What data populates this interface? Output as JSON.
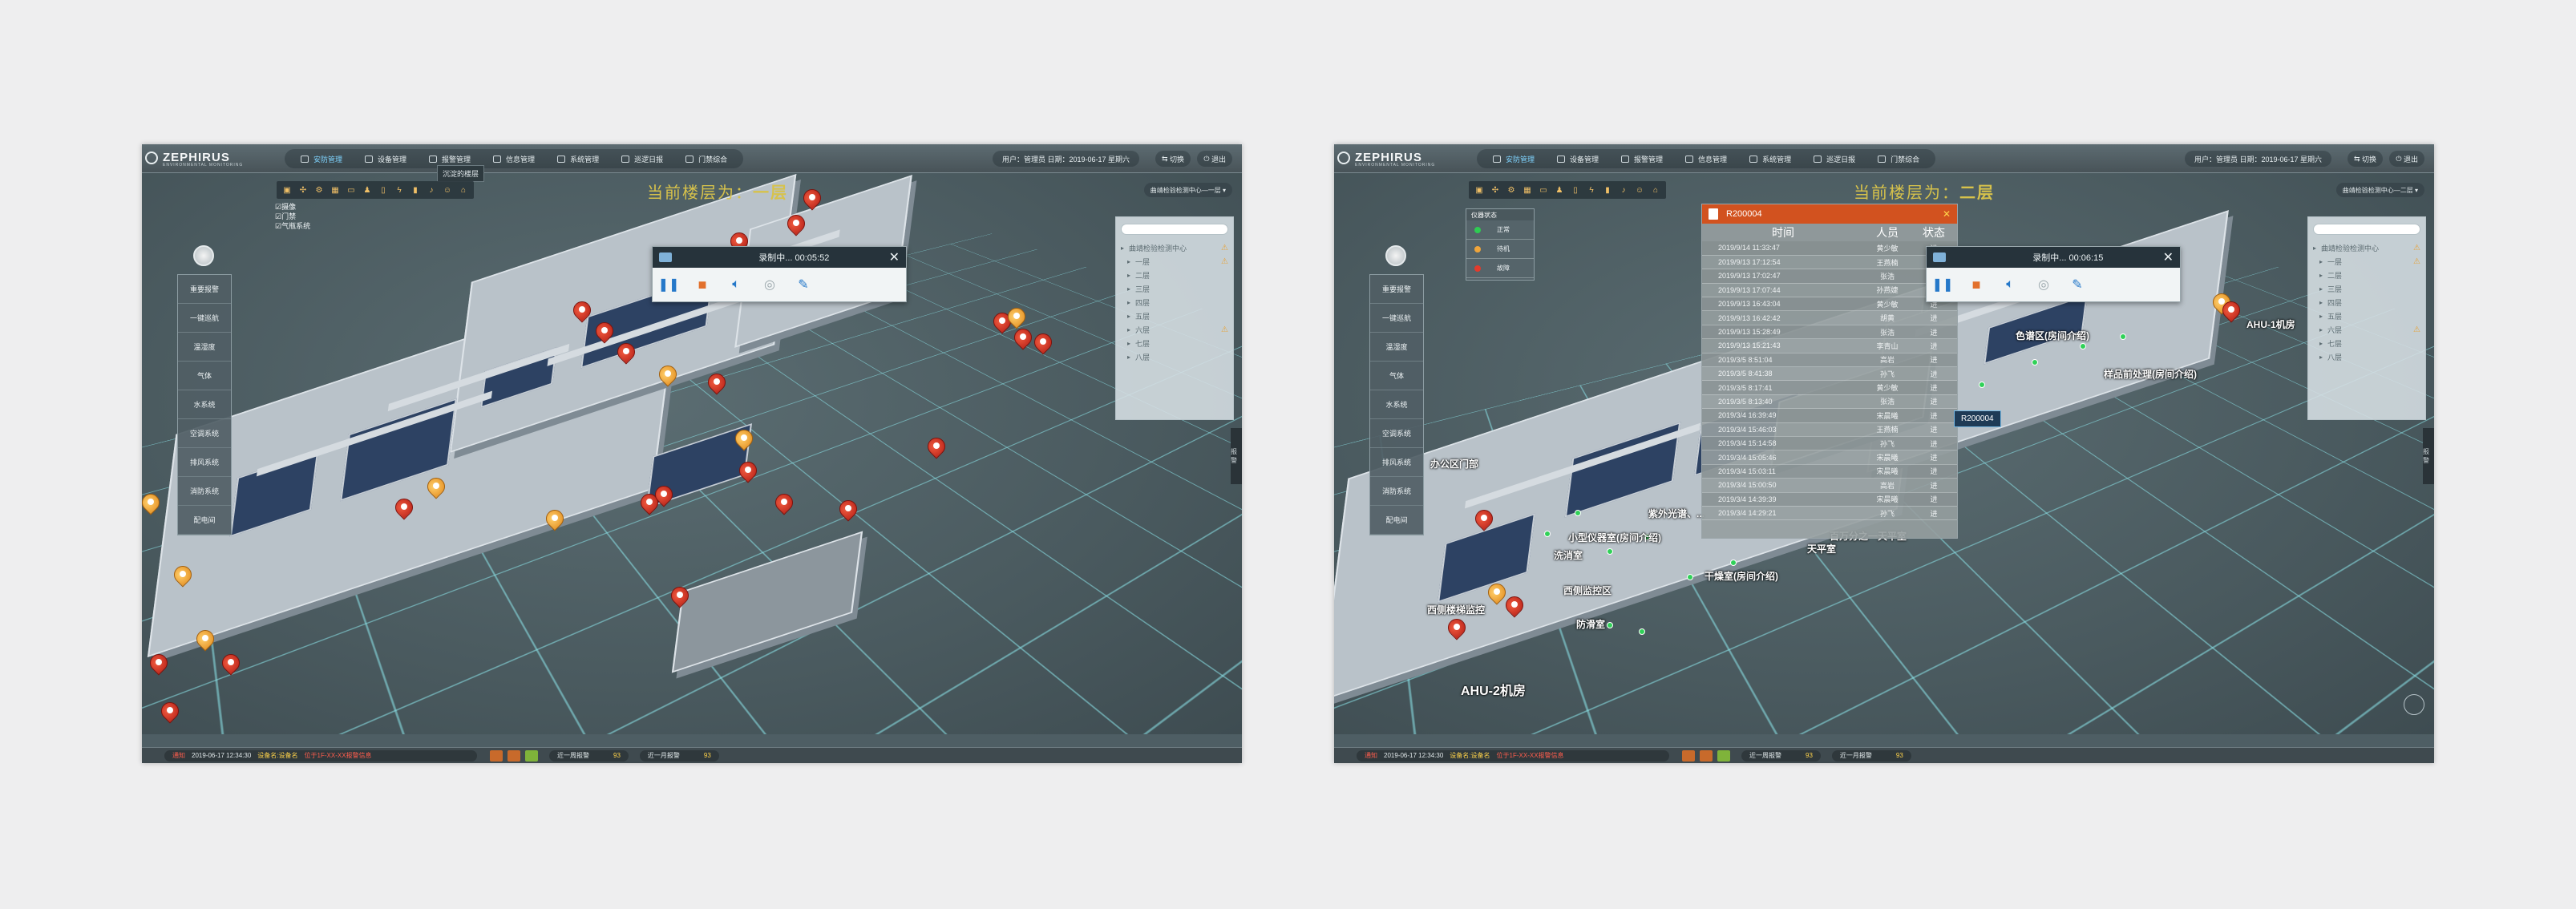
{
  "header": {
    "brand": "ZEPHIRUS",
    "brand_sub": "ENVIRONMENTAL MONITORING",
    "nav": [
      {
        "label": "安防管理",
        "active": true
      },
      {
        "label": "设备管理",
        "active": false
      },
      {
        "label": "报警管理",
        "active": false
      },
      {
        "label": "信息管理",
        "active": false
      },
      {
        "label": "系统管理",
        "active": false
      },
      {
        "label": "巡逻日报",
        "active": false
      },
      {
        "label": "门禁综合",
        "active": false
      }
    ],
    "user_info": "用户：管理员 日期：2019-06-17 星期六",
    "btn_switch": "切换",
    "btn_exit": "退出",
    "tooltip": "沉淀的楼层"
  },
  "left_screen": {
    "floor_title_prefix": "当前楼层为：",
    "floor_title_floor": "一层",
    "layer_checks": [
      "摄像",
      "门禁",
      "气瓶系统"
    ],
    "left_menu": [
      "重要报警",
      "一键巡航",
      "温湿度",
      "气体",
      "水系统",
      "空调系统",
      "排风系统",
      "消防系统",
      "配电间"
    ],
    "path_label": "曲靖检验检测中心—一层",
    "tree": [
      {
        "label": "曲靖检验检测中心",
        "warn": "⚠"
      },
      {
        "label": "一层",
        "warn": "⚠"
      },
      {
        "label": "二层",
        "warn": ""
      },
      {
        "label": "三层",
        "warn": ""
      },
      {
        "label": "四层",
        "warn": ""
      },
      {
        "label": "五层",
        "warn": ""
      },
      {
        "label": "六层",
        "warn": "⚠"
      },
      {
        "label": "七层",
        "warn": ""
      },
      {
        "label": "八层",
        "warn": ""
      }
    ],
    "player": {
      "title": "录制中... 00:05:52",
      "close": "✕"
    },
    "side_tab": "报警"
  },
  "right_screen": {
    "floor_title_prefix": "当前楼层为：",
    "floor_title_floor": "二层",
    "path_label": "曲靖检验检测中心—二层",
    "mini_legend": {
      "title": "仪器状态",
      "rows": [
        {
          "color": "#2ecc52",
          "label": "正常"
        },
        {
          "color": "#f0a53b",
          "label": "待机"
        },
        {
          "color": "#e23b2c",
          "label": "故障"
        }
      ]
    },
    "room_popup": {
      "room_id": "R200004",
      "headers": [
        "时间",
        "人员",
        "状态"
      ],
      "rows": [
        [
          "2019/9/14 11:33:47",
          "黄少敏",
          "进"
        ],
        [
          "2019/9/13 17:12:54",
          "王燕楠",
          "进"
        ],
        [
          "2019/9/13 17:02:47",
          "张浩",
          "进"
        ],
        [
          "2019/9/13 17:07:44",
          "孙燕婕",
          "进"
        ],
        [
          "2019/9/13 16:43:04",
          "黄少敏",
          "进"
        ],
        [
          "2019/9/13 16:42:42",
          "胡黄",
          "进"
        ],
        [
          "2019/9/13 15:28:49",
          "张浩",
          "进"
        ],
        [
          "2019/9/13 15:21:43",
          "李青山",
          "进"
        ],
        [
          "2019/3/5 8:51:04",
          "高岩",
          "进"
        ],
        [
          "2019/3/5 8:41:38",
          "孙飞",
          "进"
        ],
        [
          "2019/3/5 8:17:41",
          "黄少敏",
          "进"
        ],
        [
          "2019/3/5 8:13:40",
          "张浩",
          "进"
        ],
        [
          "2019/3/4 16:39:49",
          "宋晨曦",
          "进"
        ],
        [
          "2019/3/4 15:46:03",
          "王燕楠",
          "进"
        ],
        [
          "2019/3/4 15:14:58",
          "孙飞",
          "进"
        ],
        [
          "2019/3/4 15:05:46",
          "宋晨曦",
          "进"
        ],
        [
          "2019/3/4 15:03:11",
          "宋晨曦",
          "进"
        ],
        [
          "2019/3/4 15:00:50",
          "高岩",
          "进"
        ],
        [
          "2019/3/4 14:39:39",
          "宋晨曦",
          "进"
        ],
        [
          "2019/3/4 14:29:21",
          "孙飞",
          "进"
        ]
      ]
    },
    "tag_label": "R200004",
    "player": {
      "title": "录制中... 00:06:15",
      "close": "✕"
    },
    "map_labels": [
      "办公区门部",
      "紫外光谱、...",
      "小型仪器室(房间介绍)",
      "洗消室",
      "西侧监控区",
      "天平室",
      "百万分之一天平室",
      "干燥室(房间介绍)",
      "西侧楼梯监控",
      "防滑室",
      "AHU-2机房",
      "色谱区(房间介绍)",
      "样品前处理(房间介绍)",
      "AHU-1机房",
      "百万分之一天平室"
    ],
    "tree": [
      {
        "label": "曲靖检验检测中心",
        "warn": "⚠"
      },
      {
        "label": "一层",
        "warn": "⚠"
      },
      {
        "label": "二层",
        "warn": ""
      },
      {
        "label": "三层",
        "warn": ""
      },
      {
        "label": "四层",
        "warn": ""
      },
      {
        "label": "五层",
        "warn": ""
      },
      {
        "label": "六层",
        "warn": "⚠"
      },
      {
        "label": "七层",
        "warn": ""
      },
      {
        "label": "八层",
        "warn": ""
      }
    ],
    "side_tab": "报警"
  },
  "footer": {
    "status_time": "2019-06-17 12:34:30",
    "status_prefix": "通知",
    "status_text_1": "设备名:设备名",
    "status_text_2": "位于1F-XX-XX报警信息",
    "alarm_week_label": "近一周报警",
    "alarm_week_count": "93",
    "alarm_month_label": "近一月报警",
    "alarm_month_count": "93"
  },
  "colors": {
    "accent_active": "#7fd4ff",
    "floor_title": "#d7c24b",
    "pin_red": "#d8321f",
    "pin_orange": "#f0a53b",
    "popup_header": "#d2521f"
  }
}
